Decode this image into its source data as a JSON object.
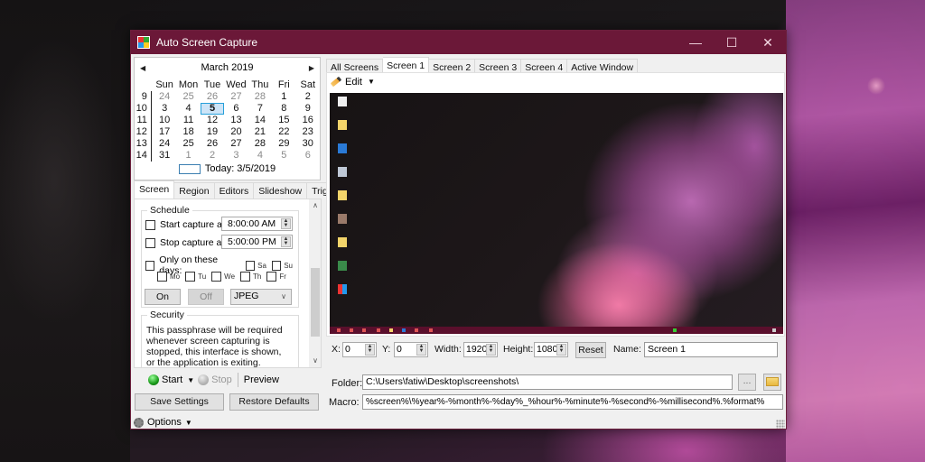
{
  "window": {
    "title": "Auto Screen Capture",
    "controls": {
      "minimize": "—",
      "maximize": "☐",
      "close": "✕"
    }
  },
  "calendar": {
    "month_label": "March 2019",
    "prev_arrow": "◀",
    "next_arrow": "▶",
    "weekdays": [
      "Sun",
      "Mon",
      "Tue",
      "Wed",
      "Thu",
      "Fri",
      "Sat"
    ],
    "weeks": [
      {
        "week": "9",
        "days": [
          "24",
          "25",
          "26",
          "27",
          "28",
          "1",
          "2"
        ],
        "dim": [
          true,
          true,
          true,
          true,
          true,
          false,
          false
        ]
      },
      {
        "week": "10",
        "days": [
          "3",
          "4",
          "5",
          "6",
          "7",
          "8",
          "9"
        ],
        "dim": [
          false,
          false,
          false,
          false,
          false,
          false,
          false
        ]
      },
      {
        "week": "11",
        "days": [
          "10",
          "11",
          "12",
          "13",
          "14",
          "15",
          "16"
        ],
        "dim": [
          false,
          false,
          false,
          false,
          false,
          false,
          false
        ]
      },
      {
        "week": "12",
        "days": [
          "17",
          "18",
          "19",
          "20",
          "21",
          "22",
          "23"
        ],
        "dim": [
          false,
          false,
          false,
          false,
          false,
          false,
          false
        ]
      },
      {
        "week": "13",
        "days": [
          "24",
          "25",
          "26",
          "27",
          "28",
          "29",
          "30"
        ],
        "dim": [
          false,
          false,
          false,
          false,
          false,
          false,
          false
        ]
      },
      {
        "week": "14",
        "days": [
          "31",
          "1",
          "2",
          "3",
          "4",
          "5",
          "6"
        ],
        "dim": [
          false,
          true,
          true,
          true,
          true,
          true,
          true
        ]
      }
    ],
    "selected_day": "5",
    "today_label": "Today: 3/5/2019"
  },
  "left_tabs": [
    "Screen",
    "Region",
    "Editors",
    "Slideshow",
    "Triggers"
  ],
  "left_active_tab": "Screen",
  "schedule": {
    "title": "Schedule",
    "start_label": "Start capture at",
    "start_time": "8:00:00 AM",
    "stop_label": "Stop capture at",
    "stop_time": "5:00:00 PM",
    "days_label": "Only on these days:",
    "days": [
      "Sa",
      "Su",
      "Mo",
      "Tu",
      "We",
      "Th",
      "Fr"
    ],
    "on_label": "On",
    "off_label": "Off",
    "format_value": "JPEG"
  },
  "security": {
    "title": "Security",
    "text": "This passphrase will be required whenever screen capturing is stopped, this interface is shown, or the application is exiting."
  },
  "capture_toolbar": {
    "start_label": "Start",
    "stop_label": "Stop",
    "preview_label": "Preview"
  },
  "settings_buttons": {
    "save_label": "Save Settings",
    "restore_label": "Restore Defaults"
  },
  "options_label": "Options",
  "right_tabs": [
    "All Screens",
    "Screen 1",
    "Screen 2",
    "Screen 3",
    "Screen 4",
    "Active Window"
  ],
  "right_active_tab": "Screen 1",
  "edit_label": "Edit",
  "screen_settings": {
    "x_label": "X:",
    "x_value": "0",
    "y_label": "Y:",
    "y_value": "0",
    "width_label": "Width:",
    "width_value": "1920",
    "height_label": "Height:",
    "height_value": "1080",
    "reset_label": "Reset",
    "name_label": "Name:",
    "name_value": "Screen 1"
  },
  "folder": {
    "label": "Folder:",
    "value": "C:\\Users\\fatiw\\Desktop\\screenshots\\",
    "browse_label": "..."
  },
  "macro": {
    "label": "Macro:",
    "value": "%screen%\\%year%-%month%-%day%_%hour%-%minute%-%second%-%millisecond%.%format%"
  }
}
